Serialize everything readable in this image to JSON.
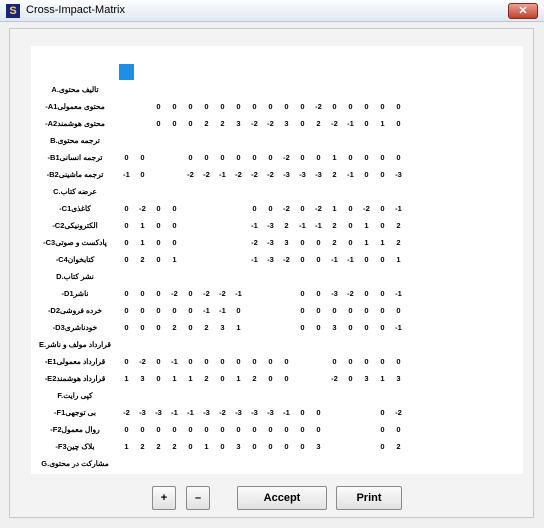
{
  "window": {
    "title": "Cross-Impact-Matrix",
    "icon_letter": "S",
    "close_glyph": "✕"
  },
  "matrix": {
    "file_name": "Scenario-Book.scw",
    "column_count": 21,
    "selected_column": 0,
    "col_groups": [
      2,
      2,
      4,
      3,
      2,
      3,
      2
    ],
    "groups": [
      {
        "label": "A.تالیف محتوی",
        "rows": [
          {
            "label": "-A1محتوی معمولی",
            "values": [
              [],
              [
                "0",
                "0"
              ],
              [
                "0",
                "0",
                "0",
                "0"
              ],
              [
                "0",
                "0",
                "0"
              ],
              [
                "0",
                "-2"
              ],
              [
                "0",
                "0",
                "0"
              ],
              [
                "0",
                "0"
              ]
            ]
          },
          {
            "label": "-A2محتوی هوشمند",
            "values": [
              [],
              [
                "0",
                "0"
              ],
              [
                "0",
                "2",
                "2",
                "3"
              ],
              [
                "-2",
                "-2",
                "3"
              ],
              [
                "0",
                "2"
              ],
              [
                "-2",
                "-1",
                "0"
              ],
              [
                "1",
                "0"
              ]
            ]
          }
        ]
      },
      {
        "label": "B.ترجمه محتوی",
        "rows": [
          {
            "label": "-B1ترجمه انسانی",
            "values": [
              [
                "0",
                "0"
              ],
              [],
              [
                "0",
                "0",
                "0",
                "0"
              ],
              [
                "0",
                "0",
                "-2"
              ],
              [
                "0",
                "0"
              ],
              [
                "1",
                "0",
                "0"
              ],
              [
                "0",
                "0"
              ]
            ]
          },
          {
            "label": "-B2ترجمه ماشینی",
            "values": [
              [
                "-1",
                "0"
              ],
              [],
              [
                "-2",
                "-2",
                "-1",
                "-2"
              ],
              [
                "-2",
                "-2",
                "-3"
              ],
              [
                "-3",
                "-3"
              ],
              [
                "2",
                "-1",
                "0"
              ],
              [
                "0",
                "-3"
              ]
            ]
          }
        ]
      },
      {
        "label": "C.عرضه کتاب",
        "rows": [
          {
            "label": "-C1کاغذی",
            "values": [
              [
                "0",
                "-2"
              ],
              [
                "0",
                "0"
              ],
              [],
              [
                "0",
                "0",
                "-2"
              ],
              [
                "0",
                "-2"
              ],
              [
                "1",
                "0",
                "-2"
              ],
              [
                "0",
                "-1"
              ]
            ]
          },
          {
            "label": "-C2الکترونیکی",
            "values": [
              [
                "0",
                "1"
              ],
              [
                "0",
                "0"
              ],
              [],
              [
                "-1",
                "-3",
                "2"
              ],
              [
                "-1",
                "-1"
              ],
              [
                "2",
                "0",
                "1"
              ],
              [
                "0",
                "2"
              ]
            ]
          },
          {
            "label": "-C3پادکست و صوتی",
            "values": [
              [
                "0",
                "1"
              ],
              [
                "0",
                "0"
              ],
              [],
              [
                "-2",
                "-3",
                "3"
              ],
              [
                "0",
                "0"
              ],
              [
                "2",
                "0",
                "1"
              ],
              [
                "1",
                "2"
              ]
            ]
          },
          {
            "label": "-C4کتابخوان",
            "values": [
              [
                "0",
                "2"
              ],
              [
                "0",
                "1"
              ],
              [],
              [
                "-1",
                "-3",
                "-2"
              ],
              [
                "0",
                "0"
              ],
              [
                "-1",
                "-1",
                "0"
              ],
              [
                "0",
                "1"
              ]
            ]
          }
        ]
      },
      {
        "label": "D.نشر کتاب",
        "rows": [
          {
            "label": "-D1ناشر",
            "values": [
              [
                "0",
                "0"
              ],
              [
                "0",
                "-2"
              ],
              [
                "0",
                "-2",
                "-2",
                "-1"
              ],
              [],
              [
                "0",
                "0"
              ],
              [
                "-3",
                "-2",
                "0"
              ],
              [
                "0",
                "-1"
              ]
            ]
          },
          {
            "label": "-D2خرده فروشی",
            "values": [
              [
                "0",
                "0"
              ],
              [
                "0",
                "0"
              ],
              [
                "0",
                "-1",
                "-1",
                "0"
              ],
              [],
              [
                "0",
                "0"
              ],
              [
                "0",
                "0",
                "0"
              ],
              [
                "0",
                "0"
              ]
            ]
          },
          {
            "label": "-D3خودناشری",
            "values": [
              [
                "0",
                "0"
              ],
              [
                "0",
                "2"
              ],
              [
                "0",
                "2",
                "3",
                "1"
              ],
              [],
              [
                "0",
                "0"
              ],
              [
                "3",
                "0",
                "0"
              ],
              [
                "0",
                "-1"
              ]
            ]
          }
        ]
      },
      {
        "label": "E.قرارداد مولف و ناشر",
        "rows": [
          {
            "label": "-E1قرارداد معمولی",
            "values": [
              [
                "0",
                "-2"
              ],
              [
                "0",
                "-1"
              ],
              [
                "0",
                "0",
                "0",
                "0"
              ],
              [
                "0",
                "0",
                "0"
              ],
              [],
              [
                "0",
                "0",
                "0"
              ],
              [
                "0",
                "0"
              ]
            ]
          },
          {
            "label": "-E2قرارداد هوشمند",
            "values": [
              [
                "1",
                "3"
              ],
              [
                "0",
                "1"
              ],
              [
                "1",
                "2",
                "0",
                "1"
              ],
              [
                "2",
                "0",
                "0"
              ],
              [],
              [
                "-2",
                "0",
                "3"
              ],
              [
                "1",
                "3"
              ]
            ]
          }
        ]
      },
      {
        "label": "F.کپی رایت",
        "rows": [
          {
            "label": "-F1بی توجهی",
            "values": [
              [
                "-2",
                "-3"
              ],
              [
                "-3",
                "-1"
              ],
              [
                "-1",
                "-3",
                "-2",
                "-3"
              ],
              [
                "-3",
                "-3",
                "-1"
              ],
              [
                "0",
                "0"
              ],
              [],
              [
                "0",
                "-2"
              ]
            ]
          },
          {
            "label": "-F2روال معمول",
            "values": [
              [
                "0",
                "0"
              ],
              [
                "0",
                "0"
              ],
              [
                "0",
                "0",
                "0",
                "0"
              ],
              [
                "0",
                "0",
                "0"
              ],
              [
                "0",
                "0"
              ],
              [],
              [
                "0",
                "0"
              ]
            ]
          },
          {
            "label": "-F3بلاک چین",
            "values": [
              [
                "1",
                "2"
              ],
              [
                "2",
                "2"
              ],
              [
                "0",
                "1",
                "0",
                "3"
              ],
              [
                "0",
                "0",
                "0"
              ],
              [
                "0",
                "3"
              ],
              [],
              [
                "0",
                "2"
              ]
            ]
          }
        ]
      },
      {
        "label": "G.مشارکت در محتوی",
        "rows": [
          {
            "label": "-G1فردی/گروهی",
            "values": [
              [
                "0",
                "0"
              ],
              [
                "0",
                "0"
              ],
              [
                "0",
                "0",
                "0",
                "0"
              ],
              [
                "0",
                "0",
                "0"
              ],
              [
                "0",
                "0"
              ],
              [
                "0",
                "0",
                "0"
              ],
              []
            ]
          },
          {
            "label": "-G2جمع‌سپاری",
            "values": [
              [
                "0",
                "3"
              ],
              [
                "1",
                "2"
              ],
              [
                "0",
                "2",
                "2",
                "2"
              ],
              [
                "0",
                "0",
                "3"
              ],
              [
                "0",
                "0"
              ],
              [
                "0",
                "0",
                "0"
              ],
              []
            ]
          }
        ]
      }
    ]
  },
  "buttons": {
    "plus": "+",
    "minus": "–",
    "accept": "Accept",
    "print": "Print"
  }
}
